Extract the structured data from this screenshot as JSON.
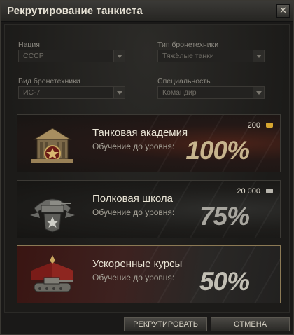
{
  "window": {
    "title": "Рекрутирование танкиста",
    "close_glyph": "✕"
  },
  "filters": {
    "nation": {
      "label": "Нация",
      "value": "СССР"
    },
    "vehicle_type": {
      "label": "Тип бронетехники",
      "value": "Тяжёлые танки"
    },
    "vehicle": {
      "label": "Вид бронетехники",
      "value": "ИС-7"
    },
    "specialty": {
      "label": "Специальность",
      "value": "Командир"
    }
  },
  "options": [
    {
      "title": "Танковая академия",
      "subtitle": "Обучение до уровня:",
      "percent": "100%",
      "price": "200",
      "currency": "gold",
      "icon": "academy-emblem-icon",
      "accent": "#c7b48d"
    },
    {
      "title": "Полковая школа",
      "subtitle": "Обучение до уровня:",
      "percent": "75%",
      "price": "20 000",
      "currency": "credits",
      "icon": "regimental-school-emblem-icon",
      "accent": "#a8a69f"
    },
    {
      "title": "Ускоренные курсы",
      "subtitle": "Обучение до уровня:",
      "percent": "50%",
      "price": "",
      "currency": "",
      "icon": "tank-courses-emblem-icon",
      "accent": "#c2bfb4"
    }
  ],
  "selected_option": 2,
  "buttons": {
    "recruit": "РЕКРУТИРОВАТЬ",
    "cancel": "ОТМЕНА"
  },
  "colors": {
    "gold": "#d7a630",
    "credits": "#b9b6ae",
    "selected_border": "#8c7a55"
  }
}
